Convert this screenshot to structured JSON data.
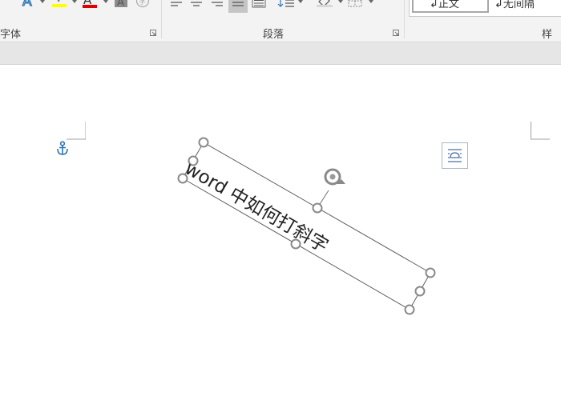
{
  "ribbon": {
    "font_group_label": "字体",
    "paragraph_group_label": "段落",
    "styles_group_label": "样式",
    "styles": [
      {
        "label": "↲正文",
        "selected": true
      },
      {
        "label": "↲无间隔",
        "selected": false
      }
    ],
    "icons": {
      "text_effects": "text-effects-icon",
      "highlight": "highlight-icon",
      "font_color": "font-color-icon",
      "char_shading": "character-shading-icon",
      "enclose_char": "enclose-character-icon",
      "align_left": "align-left-icon",
      "align_center": "align-center-icon",
      "align_right": "align-right-icon",
      "justify": "justify-icon",
      "distributed": "distributed-icon",
      "line_spacing": "line-spacing-icon",
      "shading": "shading-icon",
      "borders": "borders-icon"
    },
    "colors": {
      "highlight": "#ffff00",
      "font_color": "#e00000",
      "text_effects": "#2e75b6"
    }
  },
  "document": {
    "textbox_text": "word 中如何打斜字",
    "rotation_deg": 30
  }
}
